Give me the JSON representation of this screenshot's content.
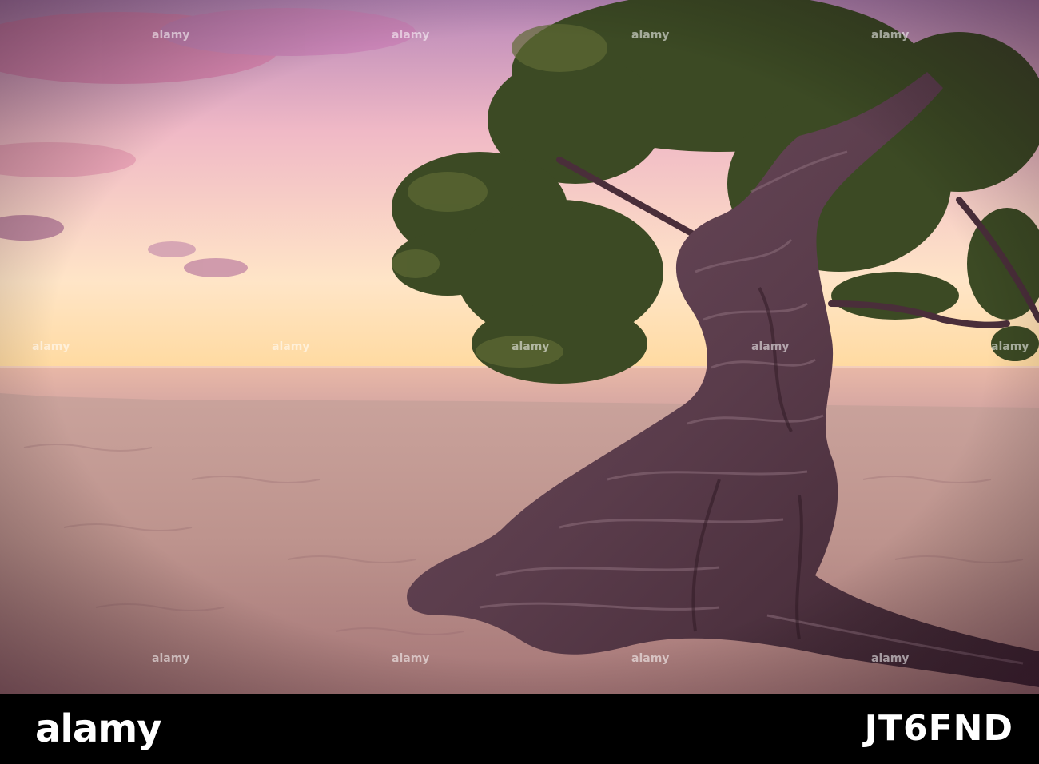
{
  "watermark": {
    "text": "alamy"
  },
  "footer": {
    "brand": "alamy",
    "image_id": "JT6FND"
  },
  "colors": {
    "sky_top": "#c98fb6",
    "sky_horizon": "#ffd7a8",
    "sea": "#f2c2b7",
    "sand": "#c59b95",
    "trunk": "#6b4a5a",
    "foliage": "#3d4a25",
    "footer_bg": "#000000"
  }
}
